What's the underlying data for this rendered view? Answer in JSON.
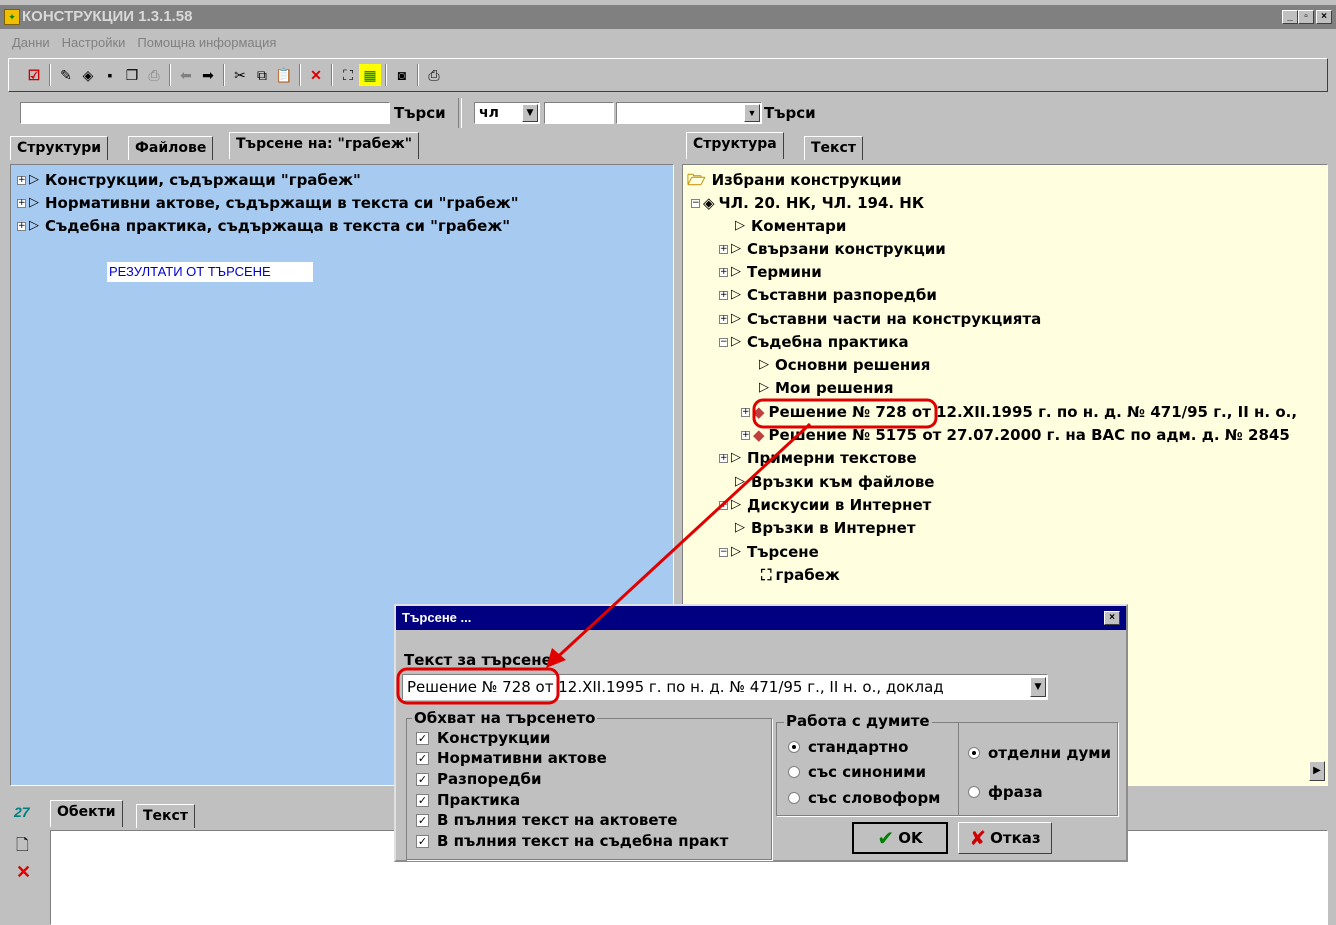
{
  "window": {
    "title": "КОНСТРУКЦИИ 1.3.1.58"
  },
  "menu": [
    "Данни",
    "Настройки",
    "Помощна информация"
  ],
  "search_bar": {
    "button1": "Търси",
    "select1": "чл",
    "button2": "Търси"
  },
  "left_tabs": [
    "Структури",
    "Файлове",
    "Търсене на: \"грабеж\""
  ],
  "left_tree": [
    "Конструкции, съдържащи \"грабеж\"",
    "Нормативни актове, съдържащи в текста си \"грабеж\"",
    "Съдебна практика, съдържаща в текста си \"грабеж\""
  ],
  "results_label": "РЕЗУЛТАТИ ОТ ТЪРСЕНЕ",
  "right_tabs": [
    "Структура",
    "Текст"
  ],
  "right_tree": {
    "root": "Избрани конструкции",
    "article": "ЧЛ. 20. НК, ЧЛ. 194. НК",
    "items": [
      "Коментари",
      "Свързани конструкции",
      "Термини",
      "Съставни разпоредби",
      "Съставни части на конструкцията",
      "Съдебна практика",
      "Основни решения",
      "Мои решения",
      "Решение № 728 от 12.XII.1995 г. по н. д. № 471/95 г., II н. о.,",
      "Решение № 5175 от 27.07.2000 г. на ВАС по адм. д. № 2845",
      "Примерни текстове",
      "Връзки към файлове",
      "Дискусии в Интернет",
      "Връзки в Интернет",
      "Търсене",
      "грабеж"
    ]
  },
  "bottom_tabs": [
    "Обекти",
    "Текст"
  ],
  "dialog": {
    "title": "Търсене ...",
    "text_label": "Текст за търсене",
    "text_value": "Решение № 728 от 12.XII.1995 г. по н. д. № 471/95 г., II н. о., доклад",
    "scope_label": "Обхват на търсенето",
    "scope": [
      "Конструкции",
      "Нормативни актове",
      "Разпоредби",
      "Практика",
      "В пълния текст на актовете",
      "В пълния текст на съдебна практ"
    ],
    "words_label": "Работа с думите",
    "words": [
      "стандартно",
      "със синоними",
      "със словоформ"
    ],
    "mode": [
      "отделни думи",
      "фраза"
    ],
    "ok": "OK",
    "cancel": "Отказ"
  }
}
